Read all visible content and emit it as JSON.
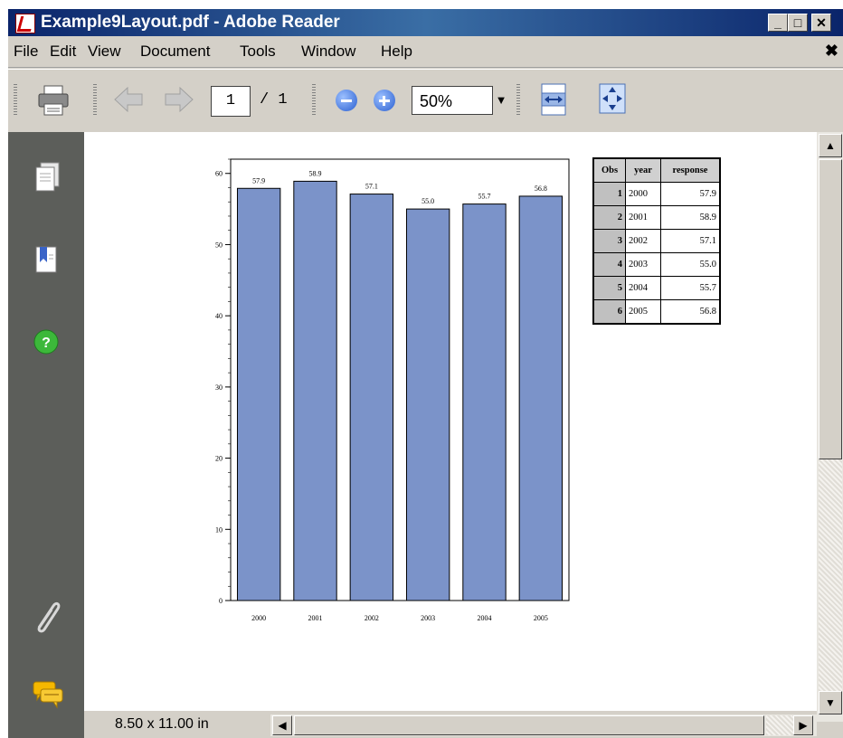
{
  "window": {
    "title": "Example9Layout.pdf - Adobe Reader",
    "controls": {
      "minimize": "_",
      "maximize": "□",
      "close": "✕"
    }
  },
  "menubar": {
    "items": [
      "File",
      "Edit",
      "View",
      "Document",
      "Tools",
      "Window",
      "Help"
    ],
    "close_doc": "✖"
  },
  "toolbar": {
    "current_page": "1",
    "page_total": "/ 1",
    "zoom": "50%"
  },
  "status": {
    "page_size": "8.50 x 11.00 in"
  },
  "colors": {
    "bar_fill": "#7b93c9",
    "nav_pane": "#5c5e5a",
    "title_bar": "#0a246a"
  },
  "chart_data": {
    "type": "bar",
    "categories": [
      "2000",
      "2001",
      "2002",
      "2003",
      "2004",
      "2005"
    ],
    "values": [
      57.9,
      58.9,
      57.1,
      55.0,
      55.7,
      56.8
    ],
    "data_labels": [
      "57.9",
      "58.9",
      "57.1",
      "55.0",
      "55.7",
      "56.8"
    ],
    "title": "",
    "xlabel": "",
    "ylabel": "",
    "ylim": [
      0,
      62
    ],
    "yticks": [
      "0",
      "10",
      "20",
      "30",
      "40",
      "50",
      "60"
    ]
  },
  "table": {
    "headers": [
      "Obs",
      "year",
      "response"
    ],
    "rows": [
      {
        "obs": "1",
        "year": "2000",
        "response": "57.9"
      },
      {
        "obs": "2",
        "year": "2001",
        "response": "58.9"
      },
      {
        "obs": "3",
        "year": "2002",
        "response": "57.1"
      },
      {
        "obs": "4",
        "year": "2003",
        "response": "55.0"
      },
      {
        "obs": "5",
        "year": "2004",
        "response": "55.7"
      },
      {
        "obs": "6",
        "year": "2005",
        "response": "56.8"
      }
    ]
  }
}
